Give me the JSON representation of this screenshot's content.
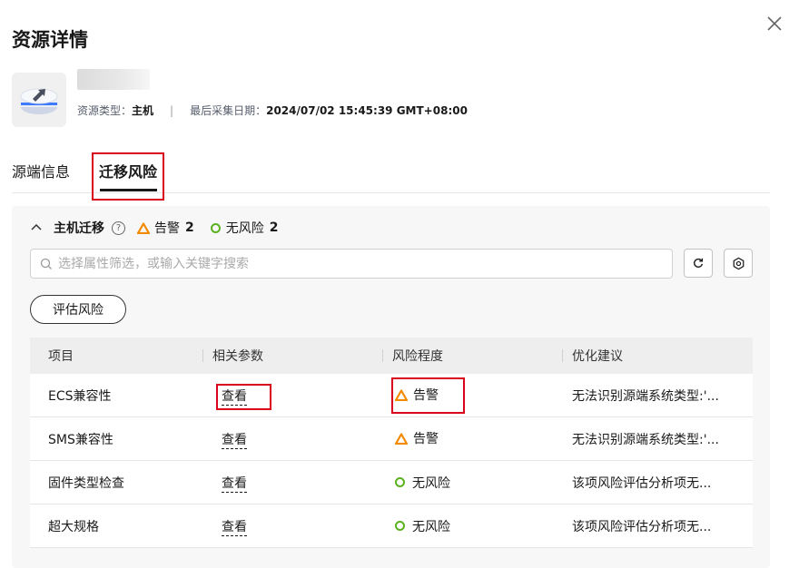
{
  "dialog": {
    "title": "资源详情"
  },
  "resource": {
    "type_label": "资源类型：",
    "type_value": "主机",
    "date_label": "最后采集日期：",
    "date_value": "2024/07/02 15:45:39 GMT+08:00"
  },
  "tabs": [
    {
      "label": "源端信息",
      "active": false
    },
    {
      "label": "迁移风险",
      "active": true
    }
  ],
  "section": {
    "title": "主机迁移",
    "warning_label": "告警",
    "warning_count": "2",
    "norisk_label": "无风险",
    "norisk_count": "2"
  },
  "search": {
    "placeholder": "选择属性筛选，或输入关键字搜索"
  },
  "eval_button": "评估风险",
  "table": {
    "headers": [
      "项目",
      "相关参数",
      "风险程度",
      "优化建议"
    ],
    "rows": [
      {
        "item": "ECS兼容性",
        "param": "查看",
        "risk": "告警",
        "level": "warning",
        "advice": "无法识别源端系统类型:'..."
      },
      {
        "item": "SMS兼容性",
        "param": "查看",
        "risk": "告警",
        "level": "warning",
        "advice": "无法识别源端系统类型:'..."
      },
      {
        "item": "固件类型检查",
        "param": "查看",
        "risk": "无风险",
        "level": "ok",
        "advice": "该项风险评估分析项无..."
      },
      {
        "item": "超大规格",
        "param": "查看",
        "risk": "无风险",
        "level": "ok",
        "advice": "该项风险评估分析项无..."
      }
    ]
  },
  "colors": {
    "warning": "#f28a00",
    "ok": "#5ab21f",
    "highlight": "#d9001b"
  }
}
